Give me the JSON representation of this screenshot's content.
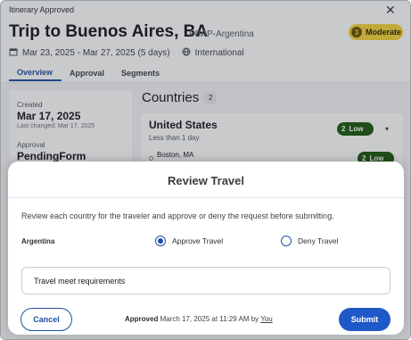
{
  "header": {
    "app_title": "Itinerary Approved",
    "close_icon": "close-icon",
    "trip_title": "Trip to Buenos Aires, BA",
    "trip_code": "PBAP-Argentina",
    "risk_level_number": "3",
    "risk_level_label": "Moderate",
    "dates": "Mar 23, 2025 - Mar 27, 2025 (5 days)",
    "scope": "International",
    "calendar_icon": "calendar-icon",
    "globe_icon": "globe-icon"
  },
  "tabs": [
    {
      "label": "Overview",
      "active": true
    },
    {
      "label": "Approval",
      "active": false
    },
    {
      "label": "Segments",
      "active": false
    }
  ],
  "left_card": {
    "created_label": "Created",
    "created_value": "Mar 17, 2025",
    "last_changed": "Last changed: Mar 17, 2025",
    "approval_label": "Approval",
    "approval_value": "PendingForm"
  },
  "countries": {
    "title": "Countries",
    "count": "2",
    "items": [
      {
        "name": "United States",
        "duration": "Less than 1 day",
        "risk_number": "2",
        "risk_label": "Low",
        "cities": [
          {
            "name": "Boston, MA",
            "risk_number": "2",
            "risk_label": "Low"
          }
        ]
      }
    ]
  },
  "modal": {
    "title": "Review Travel",
    "description": "Review each country for the traveler and approve or deny the request before submitting.",
    "country": "Argentina",
    "approve_label": "Approve Travel",
    "deny_label": "Deny Travel",
    "selected": "approve",
    "comment": "Travel meet requirements",
    "cancel_label": "Cancel",
    "submit_label": "Submit",
    "approved_word": "Approved",
    "approved_detail": " March 17, 2025 at 11:29 AM by ",
    "approved_by": "You"
  },
  "colors": {
    "accent": "#1f4fa6",
    "submit_bg": "#1f58c8",
    "moderate_badge": "#f5d33d",
    "low_badge": "#1c5a12"
  }
}
